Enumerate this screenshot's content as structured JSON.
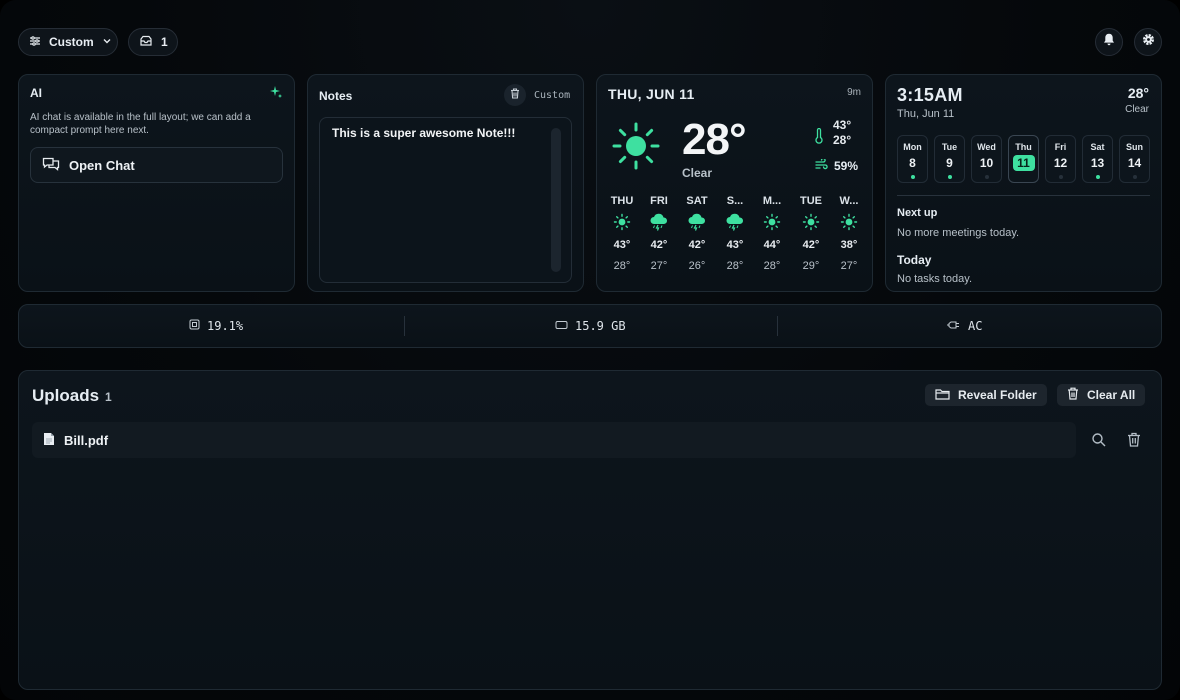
{
  "toolbar": {
    "layout_label": "Custom",
    "inbox_count": "1"
  },
  "ai": {
    "title": "AI",
    "description": "AI chat is available in the full layout; we can add a compact prompt here next.",
    "open_chat_label": "Open Chat"
  },
  "notes": {
    "title": "Notes",
    "mode": "Custom",
    "content": "This is a super awesome Note!!!"
  },
  "weather": {
    "date": "THU, JUN 11",
    "updated": "9m",
    "temp": "28°",
    "condition": "Clear",
    "high": "43°",
    "low": "28°",
    "humidity": "59%",
    "accent_color": "#3ee0a0",
    "forecast": [
      {
        "day": "THU",
        "icon": "sun-icon",
        "hi": "43°",
        "lo": "28°"
      },
      {
        "day": "FRI",
        "icon": "storm-icon",
        "hi": "42°",
        "lo": "27°"
      },
      {
        "day": "SAT",
        "icon": "storm-icon",
        "hi": "42°",
        "lo": "26°"
      },
      {
        "day": "S...",
        "icon": "storm-icon",
        "hi": "43°",
        "lo": "28°"
      },
      {
        "day": "M...",
        "icon": "sun-icon",
        "hi": "44°",
        "lo": "28°"
      },
      {
        "day": "TUE",
        "icon": "sun-icon",
        "hi": "42°",
        "lo": "29°"
      },
      {
        "day": "W...",
        "icon": "sun-icon",
        "hi": "38°",
        "lo": "27°"
      }
    ]
  },
  "calendar": {
    "time": "3:15AM",
    "date": "Thu, Jun 11",
    "temp": "28°",
    "condition": "Clear",
    "days": [
      {
        "name": "Mon",
        "num": "8",
        "has_event": true
      },
      {
        "name": "Tue",
        "num": "9",
        "has_event": true
      },
      {
        "name": "Wed",
        "num": "10",
        "has_event": false
      },
      {
        "name": "Thu",
        "num": "11",
        "has_event": false,
        "today": true
      },
      {
        "name": "Fri",
        "num": "12",
        "has_event": false
      },
      {
        "name": "Sat",
        "num": "13",
        "has_event": true
      },
      {
        "name": "Sun",
        "num": "14",
        "has_event": false
      }
    ],
    "next_up_heading": "Next up",
    "next_up_text": "No more meetings today.",
    "today_heading": "Today",
    "today_text": "No tasks today."
  },
  "stats": {
    "cpu": "19.1%",
    "memory": "15.9 GB",
    "power": "AC"
  },
  "uploads": {
    "title": "Uploads",
    "count": "1",
    "reveal_label": "Reveal Folder",
    "clear_label": "Clear All",
    "files": [
      {
        "name": "Bill.pdf"
      }
    ]
  }
}
